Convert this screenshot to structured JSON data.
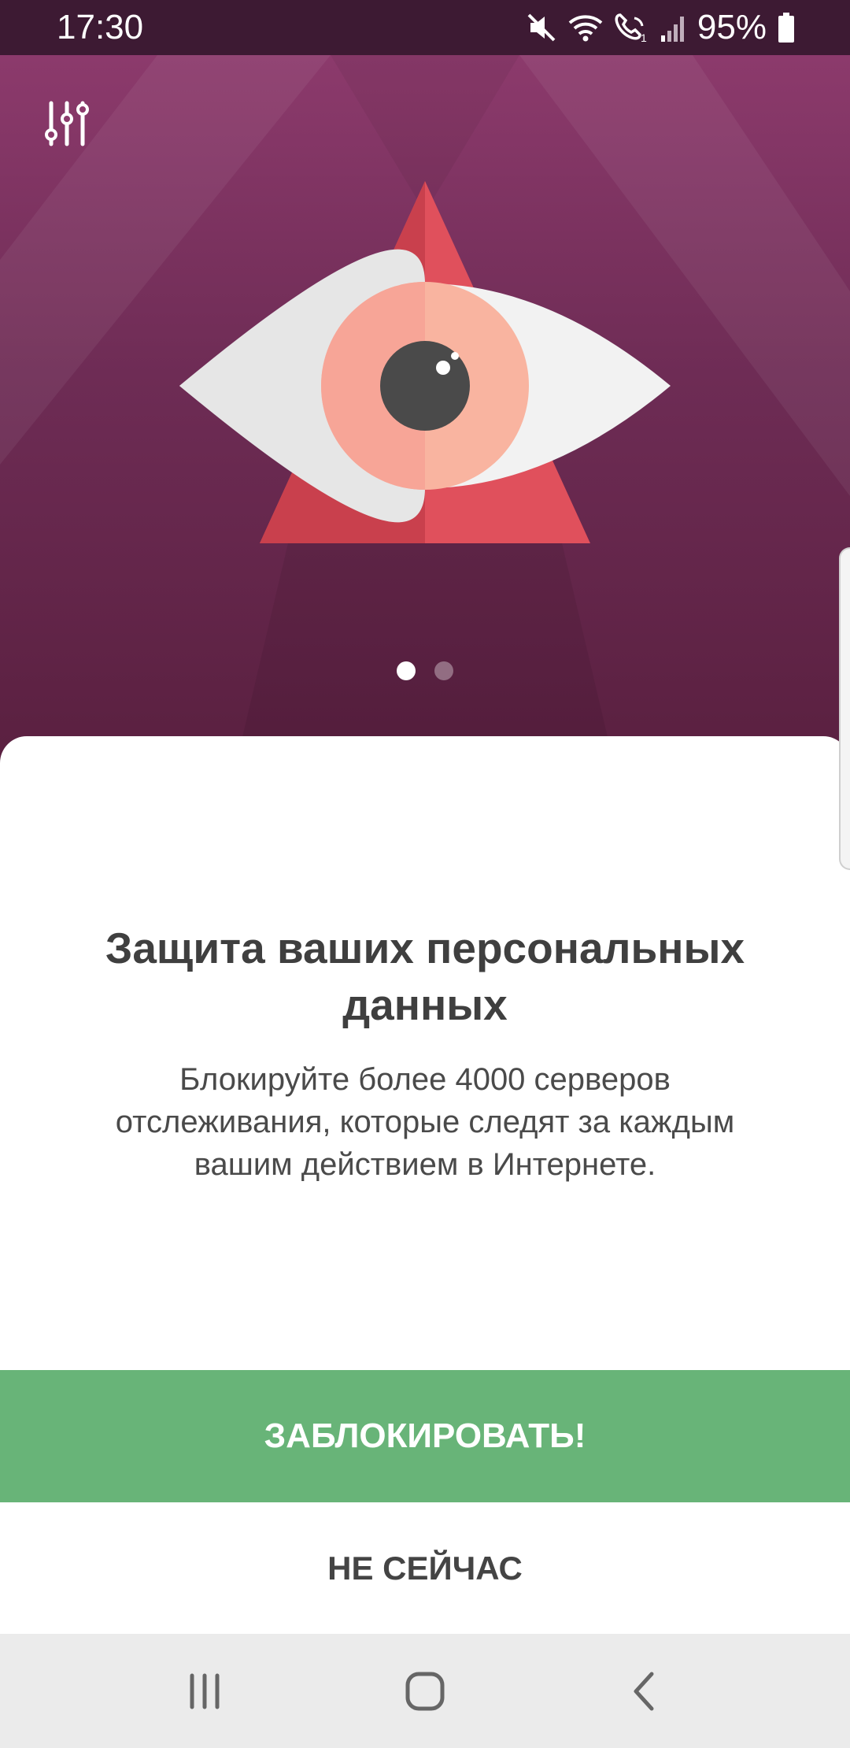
{
  "status_bar": {
    "time": "17:30",
    "battery": "95%",
    "icons": [
      "mute-icon",
      "wifi-icon",
      "wifi-call-icon",
      "signal-icon",
      "battery-icon"
    ]
  },
  "hero": {
    "filter_icon": "sliders-icon",
    "illustration": "eye-in-triangle",
    "pager": {
      "count": 2,
      "active": 0
    }
  },
  "content": {
    "title": "Защита ваших персональных данных",
    "description": "Блокируйте более 4000 серверов отслеживания, которые следят за каждым вашим действием в Интернете."
  },
  "actions": {
    "primary_label": "ЗАБЛОКИРОВАТЬ!",
    "secondary_label": "НЕ СЕЙЧАС"
  },
  "nav_bar": {
    "items": [
      "recent-apps-icon",
      "home-icon",
      "back-icon"
    ]
  },
  "colors": {
    "hero_top": "#8c3a6c",
    "hero_bottom": "#5a2040",
    "primary_button": "#68b478",
    "triangle": "#e0505c",
    "iris": "#f7a597",
    "pupil": "#4a4a4a"
  }
}
